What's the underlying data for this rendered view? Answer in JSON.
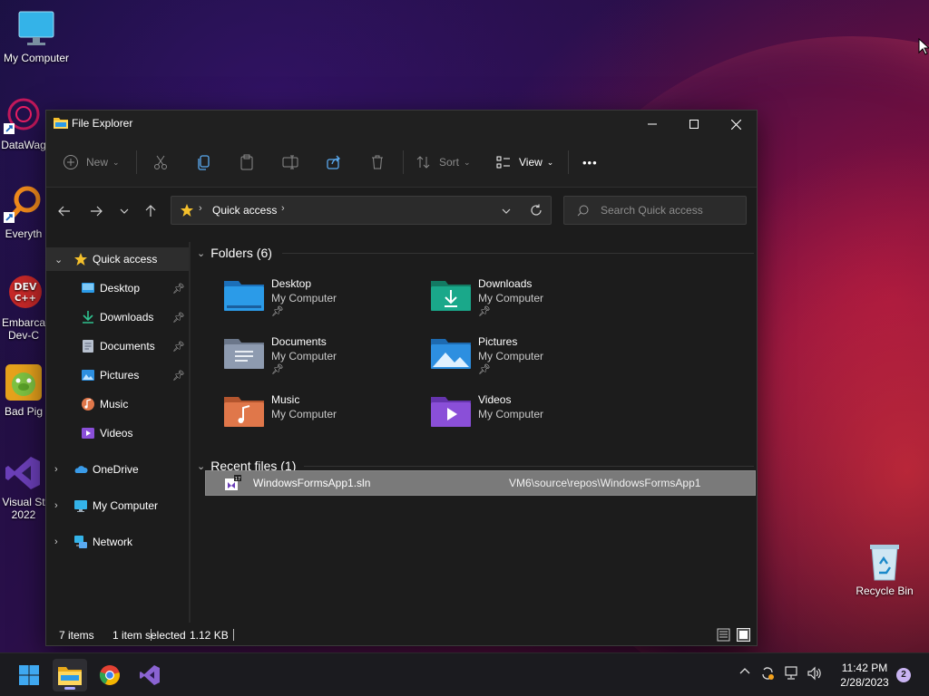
{
  "desktop": {
    "icons": [
      {
        "label": "My Computer"
      },
      {
        "label": "DataWag"
      },
      {
        "label": "Everyth"
      },
      {
        "label": "Embarca Dev-C"
      },
      {
        "label": "Bad Pig"
      },
      {
        "label": "Visual St 2022"
      },
      {
        "label": "Recycle Bin"
      }
    ]
  },
  "window": {
    "title": "File Explorer",
    "toolbar": {
      "new_label": "New",
      "sort_label": "Sort",
      "view_label": "View",
      "more_label": "•••"
    },
    "address": {
      "current": "Quick access"
    },
    "search": {
      "placeholder": "Search Quick access"
    },
    "sidebar": {
      "items": [
        {
          "label": "Quick access",
          "icon": "star-icon",
          "color": "#f4c02c"
        },
        {
          "label": "Desktop",
          "icon": "desktop-icon",
          "pinned": true
        },
        {
          "label": "Downloads",
          "icon": "download-icon",
          "pinned": true
        },
        {
          "label": "Documents",
          "icon": "document-icon",
          "pinned": true
        },
        {
          "label": "Pictures",
          "icon": "pictures-icon",
          "pinned": true
        },
        {
          "label": "Music",
          "icon": "music-icon"
        },
        {
          "label": "Videos",
          "icon": "videos-icon"
        },
        {
          "label": "OneDrive",
          "icon": "cloud-icon"
        },
        {
          "label": "My Computer",
          "icon": "computer-icon"
        },
        {
          "label": "Network",
          "icon": "network-icon"
        }
      ]
    },
    "folders_section": {
      "heading": "Folders (6)",
      "folders": [
        {
          "name": "Desktop",
          "location": "My Computer",
          "pinned": true,
          "color": "#2b9be8"
        },
        {
          "name": "Downloads",
          "location": "My Computer",
          "pinned": true,
          "color": "#1aa88a"
        },
        {
          "name": "Documents",
          "location": "My Computer",
          "pinned": true,
          "color": "#8e9bb0"
        },
        {
          "name": "Pictures",
          "location": "My Computer",
          "pinned": true,
          "color": "#2d8fe0"
        },
        {
          "name": "Music",
          "location": "My Computer",
          "pinned": false,
          "color": "#e0774a"
        },
        {
          "name": "Videos",
          "location": "My Computer",
          "pinned": false,
          "color": "#8a4fd8"
        }
      ]
    },
    "recent_section": {
      "heading": "Recent files (1)",
      "files": [
        {
          "name": "WindowsFormsApp1.sln",
          "path": "VM6\\source\\repos\\WindowsFormsApp1"
        }
      ]
    },
    "status": {
      "count": "7 items",
      "selected": "1 item selected",
      "size": "1.12 KB"
    }
  },
  "taskbar": {
    "time": "11:42 PM",
    "date": "2/28/2023",
    "notifications": "2"
  }
}
